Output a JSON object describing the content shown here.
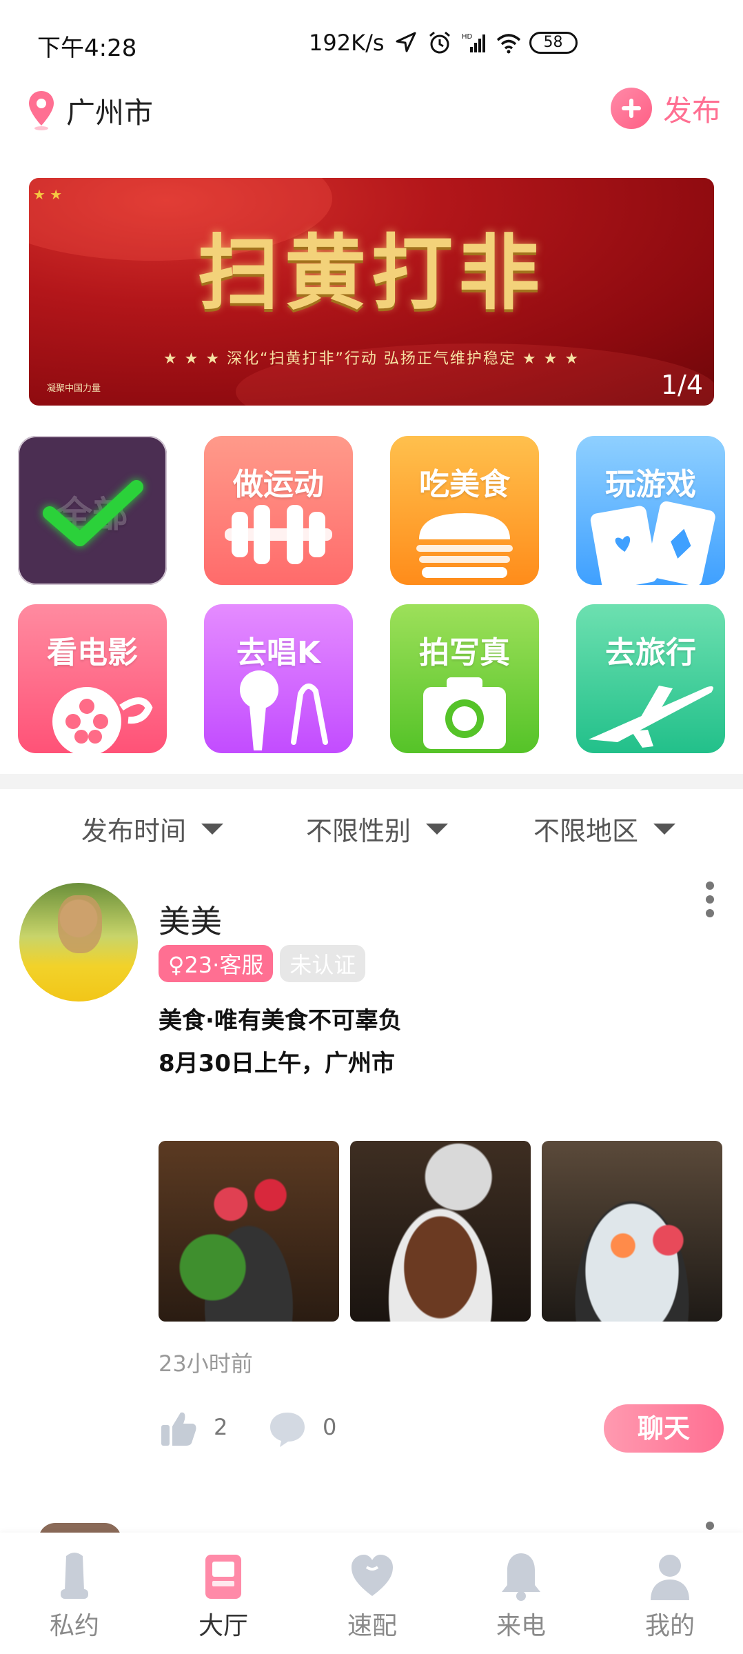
{
  "status_bar": {
    "time": "下午4:28",
    "net_speed": "192K/s",
    "battery": "58",
    "icons": [
      "location-arrow-icon",
      "alarm-icon",
      "hd-signal-icon",
      "wifi-icon",
      "battery-icon"
    ]
  },
  "header": {
    "city": "广州市",
    "publish_label": "发布"
  },
  "banner": {
    "title": "扫黄打非",
    "subtitle": "★ ★ ★ 深化“扫黄打非”行动 弘扬正气维护稳定 ★ ★ ★",
    "org": "凝聚中国力量",
    "pager": "1/4"
  },
  "categories": [
    {
      "label": "全部",
      "icon": "check-icon",
      "color": "#4b2e52"
    },
    {
      "label": "做运动",
      "icon": "dumbbell-icon",
      "color": "#ff7a74"
    },
    {
      "label": "吃美食",
      "icon": "burger-icon",
      "color": "#ffa233"
    },
    {
      "label": "玩游戏",
      "icon": "cards-icon",
      "color": "#5ab0ff"
    },
    {
      "label": "看电影",
      "icon": "film-reel-icon",
      "color": "#ff6b87"
    },
    {
      "label": "去唱K",
      "icon": "microphone-icon",
      "color": "#d268ff"
    },
    {
      "label": "拍写真",
      "icon": "camera-icon",
      "color": "#77d13f"
    },
    {
      "label": "去旅行",
      "icon": "airplane-icon",
      "color": "#3ccf9a"
    }
  ],
  "filters": {
    "time": "发布时间",
    "gender": "不限性别",
    "region": "不限地区"
  },
  "post": {
    "name": "美美",
    "gender_badge": "♀23·客服",
    "verify_badge": "未认证",
    "line1": "美食·唯有美食不可辜负",
    "line2": "8月30日上午，广州市",
    "time_ago": "23小时前",
    "likes": "2",
    "comments": "0",
    "chat_label": "聊天"
  },
  "nav": {
    "items": [
      {
        "label": "私约",
        "icon": "condom-icon"
      },
      {
        "label": "大厅",
        "icon": "hall-icon"
      },
      {
        "label": "速配",
        "icon": "heart-icon"
      },
      {
        "label": "来电",
        "icon": "bell-icon"
      },
      {
        "label": "我的",
        "icon": "user-icon"
      }
    ],
    "active_index": 1
  },
  "colors": {
    "accent": "#ff6f92",
    "banner_red": "#b3161a",
    "text_dark": "#222222",
    "text_muted": "#999999"
  }
}
